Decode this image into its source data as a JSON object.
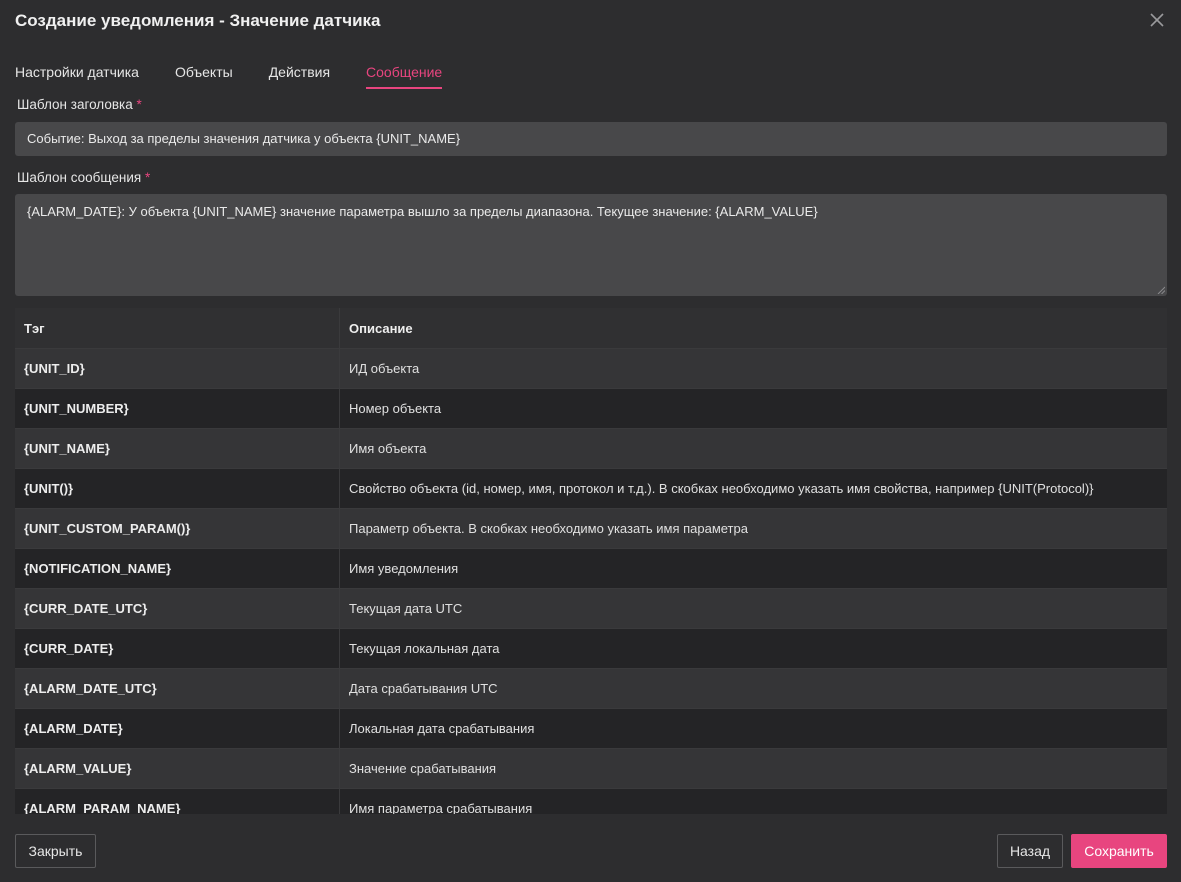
{
  "dialog": {
    "title": "Создание уведомления - Значение датчика",
    "close_icon": "close-icon"
  },
  "tabs": [
    {
      "label": "Настройки датчика",
      "active": false
    },
    {
      "label": "Объекты",
      "active": false
    },
    {
      "label": "Действия",
      "active": false
    },
    {
      "label": "Сообщение",
      "active": true
    }
  ],
  "subject": {
    "label": "Шаблон заголовка",
    "required_mark": "*",
    "value": "Событие: Выход за пределы значения датчика  у объекта {UNIT_NAME}"
  },
  "message": {
    "label": "Шаблон сообщения",
    "required_mark": "*",
    "value": "{ALARM_DATE}: У объекта {UNIT_NAME} значение параметра  вышло за пределы диапазона. Текущее значение: {ALARM_VALUE}"
  },
  "tags_table": {
    "headers": {
      "tag": "Тэг",
      "description": "Описание"
    },
    "rows": [
      {
        "tag": "{UNIT_ID}",
        "description": "ИД объекта"
      },
      {
        "tag": "{UNIT_NUMBER}",
        "description": "Номер объекта"
      },
      {
        "tag": "{UNIT_NAME}",
        "description": "Имя объекта"
      },
      {
        "tag": "{UNIT()}",
        "description": "Свойство объекта (id, номер, имя, протокол и т.д.). В скобках необходимо указать имя свойства, например {UNIT(Protocol)}"
      },
      {
        "tag": "{UNIT_CUSTOM_PARAM()}",
        "description": "Параметр объекта. В скобках необходимо указать имя параметра"
      },
      {
        "tag": "{NOTIFICATION_NAME}",
        "description": "Имя уведомления"
      },
      {
        "tag": "{CURR_DATE_UTC}",
        "description": "Текущая дата UTC"
      },
      {
        "tag": "{CURR_DATE}",
        "description": "Текущая локальная дата"
      },
      {
        "tag": "{ALARM_DATE_UTC}",
        "description": "Дата срабатывания UTC"
      },
      {
        "tag": "{ALARM_DATE}",
        "description": "Локальная дата срабатывания"
      },
      {
        "tag": "{ALARM_VALUE}",
        "description": "Значение срабатывания"
      },
      {
        "tag": "{ALARM_PARAM_NAME}",
        "description": "Имя параметра срабатывания"
      }
    ]
  },
  "footer": {
    "close_label": "Закрыть",
    "back_label": "Назад",
    "save_label": "Сохранить"
  },
  "colors": {
    "accent": "#e8457f",
    "background": "#2d2d2f",
    "input_background": "#48484a"
  }
}
